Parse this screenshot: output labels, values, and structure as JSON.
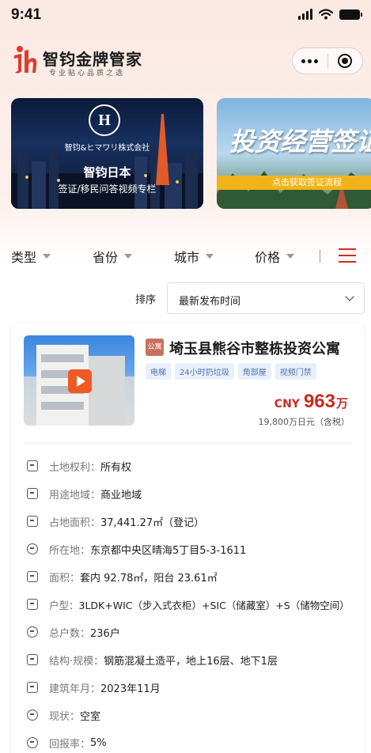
{
  "status_bar": {
    "time": "9:41"
  },
  "header": {
    "brand_name": "智钧金牌管家",
    "brand_tagline": "专业贴心品质之选"
  },
  "banners": [
    {
      "logo_letter": "H",
      "company": "智钧&ヒマワリ株式会社",
      "title": "智钧日本",
      "subtitle": "签证/移民问答视频专栏"
    },
    {
      "title": "投资经营签证",
      "cta": "点击获取签证流程"
    }
  ],
  "filters": {
    "items": [
      {
        "label": "类型"
      },
      {
        "label": "省份"
      },
      {
        "label": "城市"
      },
      {
        "label": "价格"
      }
    ]
  },
  "sort": {
    "label": "排序",
    "value": "最新发布时间"
  },
  "listing": {
    "type_badge": "公寓",
    "title": "埼玉县熊谷市整栋投资公寓",
    "tags": [
      "电梯",
      "24小时扔垃圾",
      "角部屋",
      "视频门禁"
    ],
    "price": {
      "currency": "CNY",
      "amount": "963",
      "unit": "万",
      "jpy_text": "19,800万日元（含税）"
    },
    "details": [
      {
        "icon": "document-icon",
        "label": "土地权利：",
        "value": "所有权"
      },
      {
        "icon": "cube-icon",
        "label": "用途地域：",
        "value": "商业地域"
      },
      {
        "icon": "area-icon",
        "label": "占地面积：",
        "value": "37,441.27㎡（登记）"
      },
      {
        "icon": "location-pin-icon",
        "label": "所在地：",
        "value": "东京都中央区晴海5丁目5-3-1611"
      },
      {
        "icon": "floorplan-icon",
        "label": "面积：",
        "value": "套内 92.78㎡，阳台 23.61㎡"
      },
      {
        "icon": "layout-icon",
        "label": "户型：",
        "value": "3LDK+WIC（步入式衣柜）+SIC（储藏室）+S（储物空间）"
      },
      {
        "icon": "people-icon",
        "label": "总户数：",
        "value": "236户"
      },
      {
        "icon": "structure-icon",
        "label": "结构·规模：",
        "value": "钢筋混凝土造平，地上16层、地下1层"
      },
      {
        "icon": "building-icon",
        "label": "建筑年月：",
        "value": "2023年11月"
      },
      {
        "icon": "status-icon",
        "label": "现状：",
        "value": "空室"
      },
      {
        "icon": "return-rate-icon",
        "label": "回报率：",
        "value": "5%"
      }
    ]
  },
  "colors": {
    "accent_red": "#cc2a22",
    "tag_bg": "#e9f0fb",
    "badge_bg": "#c9705f"
  }
}
